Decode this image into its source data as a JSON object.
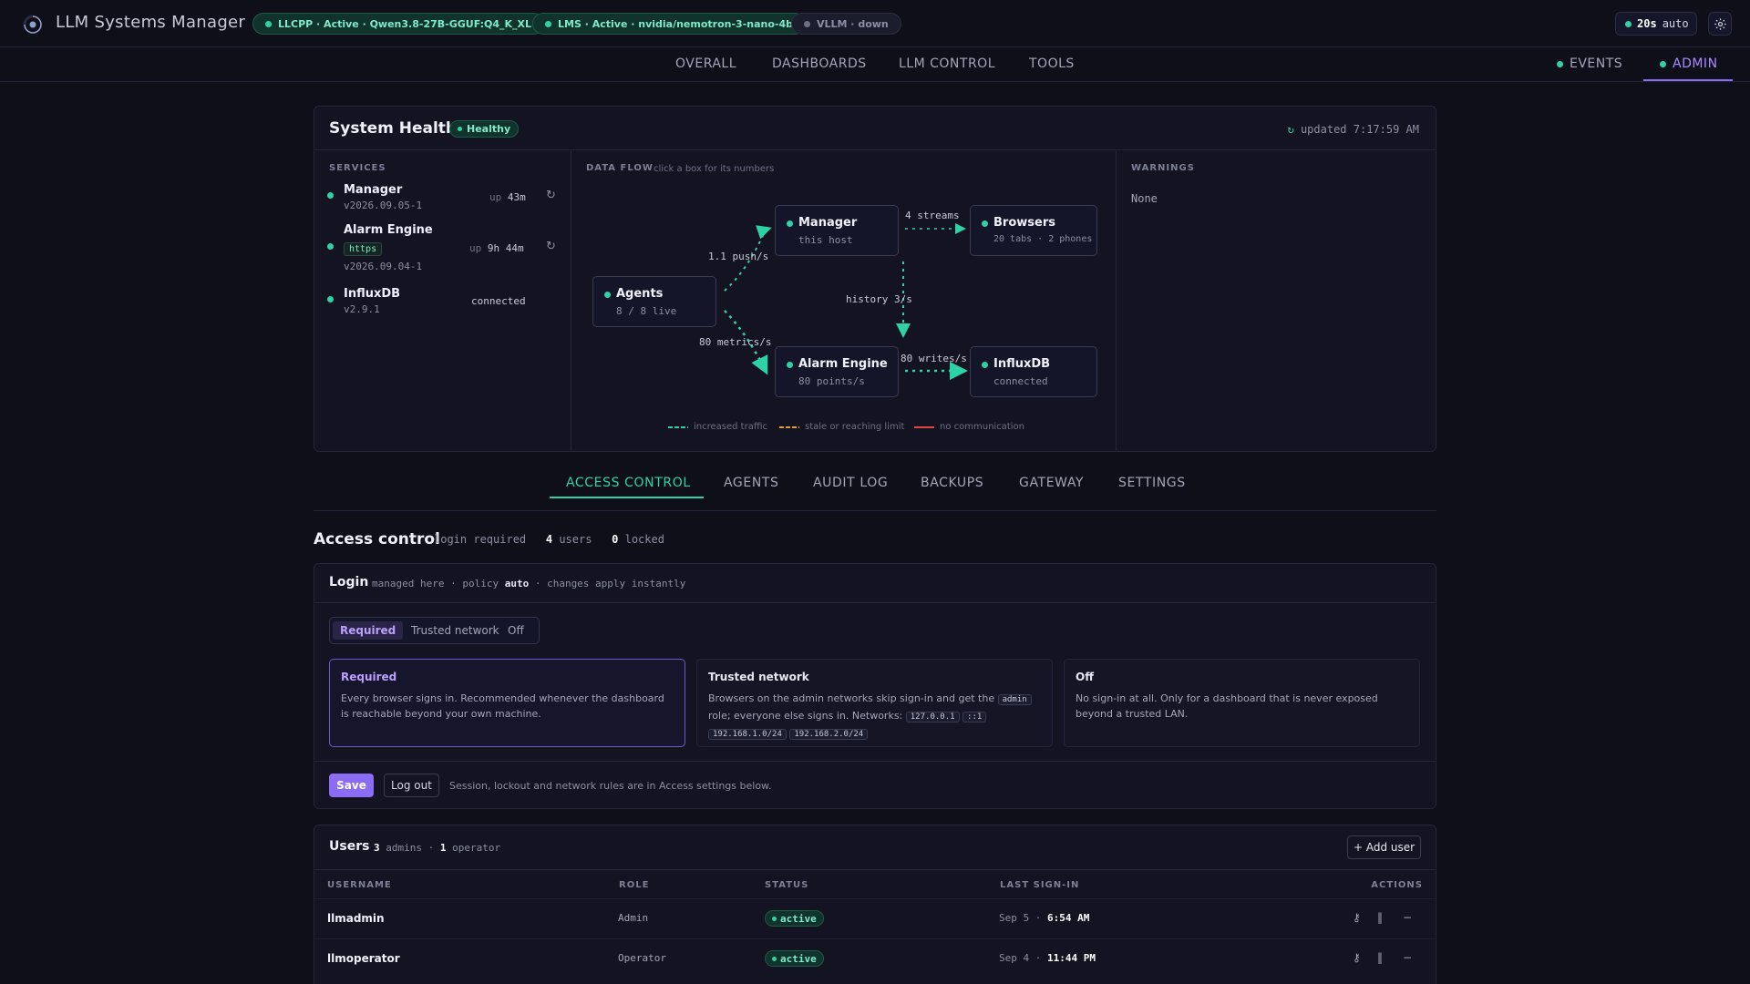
{
  "app": {
    "title": "LLM Systems Manager"
  },
  "status_pills": [
    {
      "text": "LLCPP · Active · Qwen3.8-27B-GGUF:Q4_K_XL",
      "state": "active"
    },
    {
      "text": "LMS · Active · nvidia/nemotron-3-nano-4b",
      "state": "active"
    },
    {
      "text": "VLLM · down",
      "state": "down"
    }
  ],
  "refresh": {
    "interval": "20s",
    "mode": "auto"
  },
  "nav": {
    "main": [
      "OVERALL",
      "DASHBOARDS",
      "LLM CONTROL",
      "TOOLS"
    ],
    "events": "EVENTS",
    "admin": "ADMIN",
    "active": "ADMIN"
  },
  "health": {
    "title": "System Health",
    "badge": "Healthy",
    "updated": "updated 7:17:59 AM",
    "services_heading": "SERVICES",
    "services": [
      {
        "name": "Manager",
        "version": "v2026.09.05-1",
        "uptime_prefix": "up",
        "uptime": "43m",
        "restart": true
      },
      {
        "name": "Alarm Engine",
        "tag": "https",
        "version": "v2026.09.04-1",
        "uptime_prefix": "up",
        "uptime": "9h 44m",
        "restart": true
      },
      {
        "name": "InfluxDB",
        "version": "v2.9.1",
        "status": "connected"
      }
    ],
    "flow_heading": "DATA FLOW",
    "flow_hint": "click a box for its numbers",
    "nodes": {
      "manager": {
        "name": "Manager",
        "sub": "this host"
      },
      "browsers": {
        "name": "Browsers",
        "sub": "20 tabs · 2 phones"
      },
      "agents": {
        "name": "Agents",
        "sub": "8 / 8 live"
      },
      "alarm": {
        "name": "Alarm Engine",
        "sub": "80 points/s"
      },
      "influx": {
        "name": "InfluxDB",
        "sub": "connected"
      }
    },
    "edges": {
      "streams": "4 streams",
      "push": "1.1 push/s",
      "history": "history 3/s",
      "metrics": "80 metrics/s",
      "writes": "80 writes/s"
    },
    "legend": [
      {
        "label": "increased traffic",
        "color": "#2ed3a5"
      },
      {
        "label": "stale or reaching limit",
        "color": "#e0a030"
      },
      {
        "label": "no communication",
        "color": "#e04848"
      }
    ],
    "warnings_heading": "WARNINGS",
    "warnings": "None"
  },
  "tabs": {
    "items": [
      "ACCESS CONTROL",
      "AGENTS",
      "AUDIT LOG",
      "BACKUPS",
      "GATEWAY",
      "SETTINGS"
    ],
    "active": "ACCESS CONTROL"
  },
  "access": {
    "title": "Access control",
    "meta_login": "login required",
    "users_count": "4",
    "users_label": "users",
    "locked_count": "0",
    "locked_label": "locked"
  },
  "login": {
    "title": "Login",
    "meta_prefix": "managed here · policy",
    "policy": "auto",
    "meta_suffix": "· changes apply instantly",
    "options": [
      "Required",
      "Trusted network",
      "Off"
    ],
    "selected": "Required",
    "modes": [
      {
        "title": "Required",
        "desc": "Every browser signs in. Recommended whenever the dashboard is reachable beyond your own machine."
      },
      {
        "title": "Trusted network",
        "desc_a": "Browsers on the admin networks skip sign-in and get the",
        "code_role": "admin",
        "desc_b": "role; everyone else signs in. Networks:",
        "networks": [
          "127.0.0.1",
          "::1",
          "192.168.1.0/24",
          "192.168.2.0/24"
        ]
      },
      {
        "title": "Off",
        "desc": "No sign-in at all. Only for a dashboard that is never exposed beyond a trusted LAN."
      }
    ],
    "save": "Save",
    "logout": "Log out",
    "note": "Session, lockout and network rules are in Access settings below."
  },
  "users": {
    "title": "Users",
    "admins_count": "3",
    "admins_label": "admins ·",
    "operators_count": "1",
    "operators_label": "operator",
    "add_button": "+ Add user",
    "columns": [
      "USERNAME",
      "ROLE",
      "STATUS",
      "LAST SIGN-IN",
      "ACTIONS"
    ],
    "rows": [
      {
        "username": "llmadmin",
        "role": "Admin",
        "status": "active",
        "last_date": "Sep 5 ·",
        "last_time": "6:54 AM"
      },
      {
        "username": "llmoperator",
        "role": "Operator",
        "status": "active",
        "last_date": "Sep 4 ·",
        "last_time": "11:44 PM"
      }
    ]
  }
}
